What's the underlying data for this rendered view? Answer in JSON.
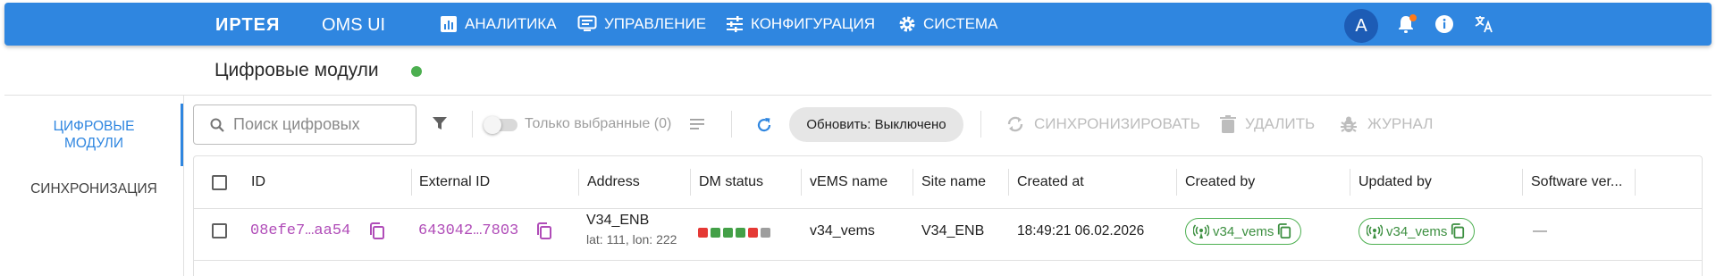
{
  "header": {
    "brand": "ИРТЕЯ",
    "product": "OMS UI",
    "nav": [
      {
        "label": "АНАЛИТИКА",
        "icon": "bar-chart-icon"
      },
      {
        "label": "УПРАВЛЕНИЕ",
        "icon": "monitor-icon"
      },
      {
        "label": "КОНФИГУРАЦИЯ",
        "icon": "sliders-icon"
      },
      {
        "label": "СИСТЕМА",
        "icon": "gear-icon"
      }
    ],
    "avatar": "A",
    "colors": {
      "appbar": "#2f86e0",
      "notification_dot": "#ff7a1a"
    }
  },
  "page": {
    "title": "Цифровые модули",
    "status_color": "#4caf50"
  },
  "sidebar": {
    "items": [
      {
        "label_line1": "ЦИФРОВЫЕ",
        "label_line2": "МОДУЛИ",
        "active": true
      },
      {
        "label": "СИНХРОНИЗАЦИЯ",
        "active": false
      }
    ]
  },
  "toolbar": {
    "search_placeholder": "Поиск цифровых",
    "only_selected_label": "Только выбранные (0)",
    "refresh_label": "Обновить: Выключено",
    "sync_label": "СИНХРОНИЗИРОВАТЬ",
    "delete_label": "УДАЛИТЬ",
    "journal_label": "ЖУРНАЛ"
  },
  "table": {
    "columns": [
      "ID",
      "External ID",
      "Address",
      "DM status",
      "vEMS name",
      "Site name",
      "Created at",
      "Created by",
      "Updated by",
      "Software ver..."
    ],
    "rows": [
      {
        "id": "08efe7…aa54",
        "external_id": "643042…7803",
        "address": "V34_ENB",
        "address_sub": "lat: 111, lon: 222",
        "dm_status": [
          "#e53935",
          "#43a047",
          "#43a047",
          "#43a047",
          "#e53935",
          "#9e9e9e"
        ],
        "vems_name": "v34_vems",
        "site_name": "V34_ENB",
        "created_at": "18:49:21 06.02.2026",
        "created_by": "v34_vems",
        "updated_by": "v34_vems",
        "software_version": "—"
      }
    ]
  }
}
